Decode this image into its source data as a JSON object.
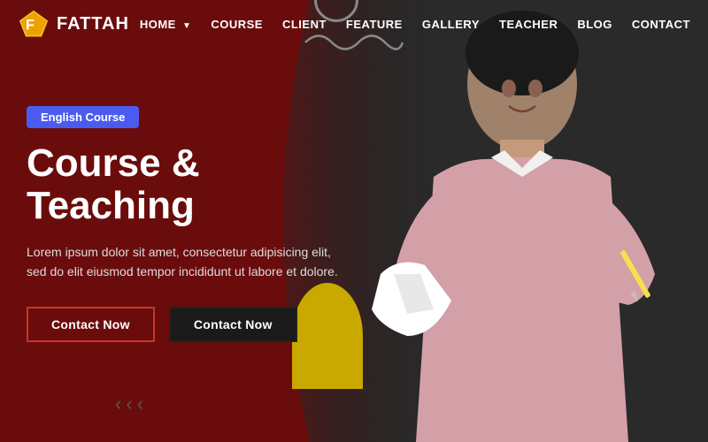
{
  "brand": {
    "name": "FATTAH"
  },
  "nav": {
    "links": [
      {
        "label": "HOME",
        "hasDropdown": true,
        "active": true
      },
      {
        "label": "COURSE",
        "hasDropdown": false,
        "active": false
      },
      {
        "label": "CLIENT",
        "hasDropdown": false,
        "active": false
      },
      {
        "label": "FEATURE",
        "hasDropdown": false,
        "active": false
      },
      {
        "label": "GALLERY",
        "hasDropdown": false,
        "active": false
      },
      {
        "label": "TEACHER",
        "hasDropdown": false,
        "active": false
      },
      {
        "label": "BLOG",
        "hasDropdown": false,
        "active": false
      },
      {
        "label": "CONTACT",
        "hasDropdown": false,
        "active": false
      }
    ]
  },
  "hero": {
    "badge": "English Course",
    "title": "Course & Teaching",
    "description": "Lorem ipsum dolor sit amet, consectetur adipisicing elit, sed do elit eiusmod tempor incididunt ut labore et dolore.",
    "button1": "Contact Now",
    "button2": "Contact Now"
  },
  "colors": {
    "accent_blue": "#4a5cf0",
    "bg_dark_red": "#6b0c0c",
    "yellow": "#c9a800",
    "btn_red_border": "#c0392b",
    "btn_dark": "#1a1a1a"
  }
}
